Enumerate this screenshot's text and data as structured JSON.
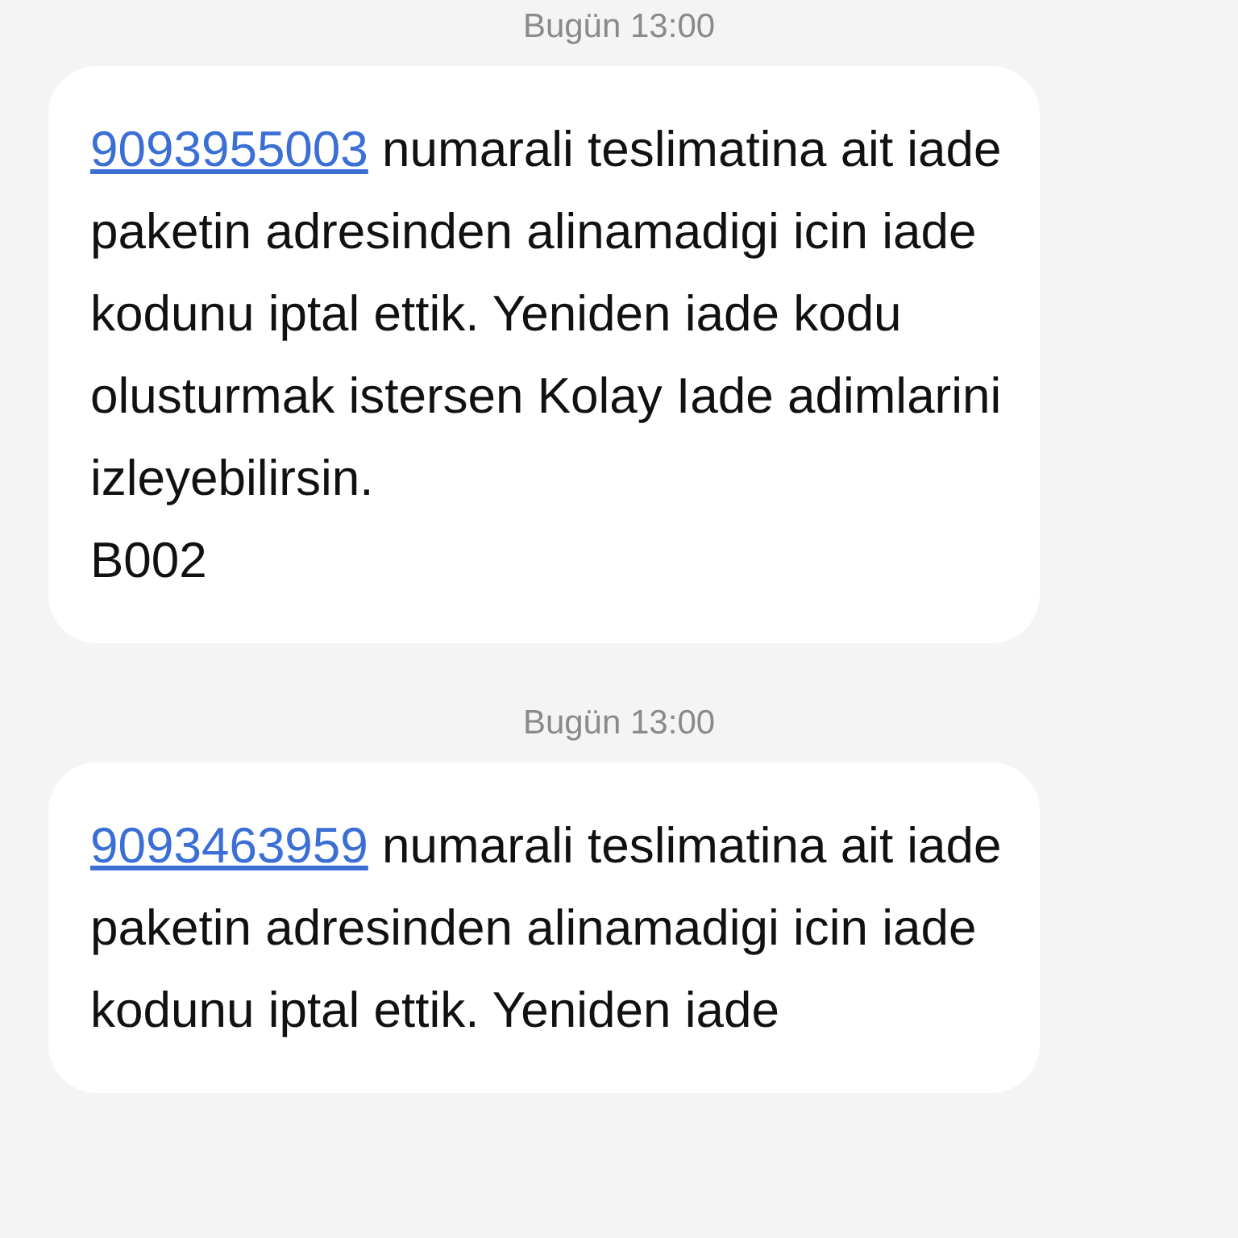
{
  "messages": [
    {
      "timestamp": "Bugün 13:00",
      "number": "9093955003",
      "text": "numarali teslimatina ait iade paketin adresinden alinamadigi icin iade kodunu iptal ettik. Yeniden iade kodu olusturmak istersen Kolay Iade adimlarini izleyebilirsin.\nB002"
    },
    {
      "timestamp": "Bugün 13:00",
      "number": "9093463959",
      "text": "numarali teslimatina ait iade paketin adresinden alinamadigi icin iade kodunu iptal ettik. Yeniden iade"
    }
  ]
}
